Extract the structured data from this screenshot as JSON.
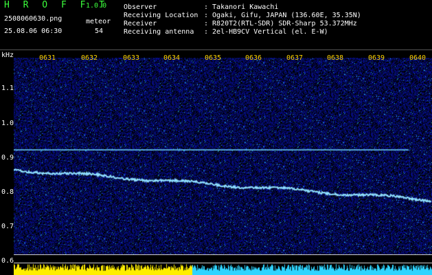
{
  "header": {
    "logo": "H R O F F T",
    "version": "1.0.0",
    "filename": "2508060630.png",
    "meteor_label": "meteor",
    "datetime": "25.08.06 06:30",
    "meteor_count": "54"
  },
  "info": [
    {
      "key": "Observer",
      "value": ": Takanori Kawachi"
    },
    {
      "key": "Receiving Location",
      "value": ": Ogaki, Gifu, JAPAN (136.60E, 35.35N)"
    },
    {
      "key": "Receiver",
      "value": ": R820T2(RTL-SDR) SDR-Sharp 53.372MHz"
    },
    {
      "key": "Receiving antenna",
      "value": ": 2el-HB9CV Vertical (el. E-W)"
    }
  ],
  "axis": {
    "unit": "kHz",
    "time_ticks": [
      "0631",
      "0632",
      "0633",
      "0634",
      "0635",
      "0636",
      "0637",
      "0638",
      "0639",
      "0640"
    ],
    "freq_ticks": [
      "1.1",
      "1.0",
      "0.9",
      "0.8",
      "0.7",
      "0.6"
    ]
  },
  "colors": {
    "logo": "#3cff3c",
    "tick_labels": "#ffd400",
    "signal_cyan": "#3fd0ff",
    "background_noise": "#10186a"
  }
}
